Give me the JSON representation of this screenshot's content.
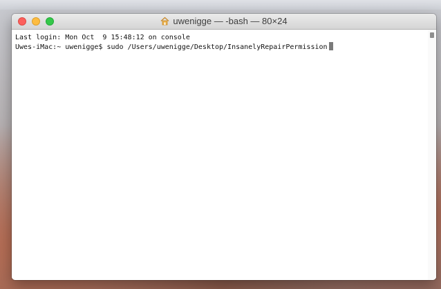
{
  "window": {
    "title": "uwenigge — -bash — 80×24"
  },
  "terminal": {
    "lines": [
      "Last login: Mon Oct  9 15:48:12 on console",
      "Uwes-iMac:~ uwenigge$ sudo /Users/uwenigge/Desktop/InsanelyRepairPermission"
    ]
  },
  "colors": {
    "close": "#fc605c",
    "minimize": "#fdbc40",
    "zoom": "#34c84a"
  }
}
